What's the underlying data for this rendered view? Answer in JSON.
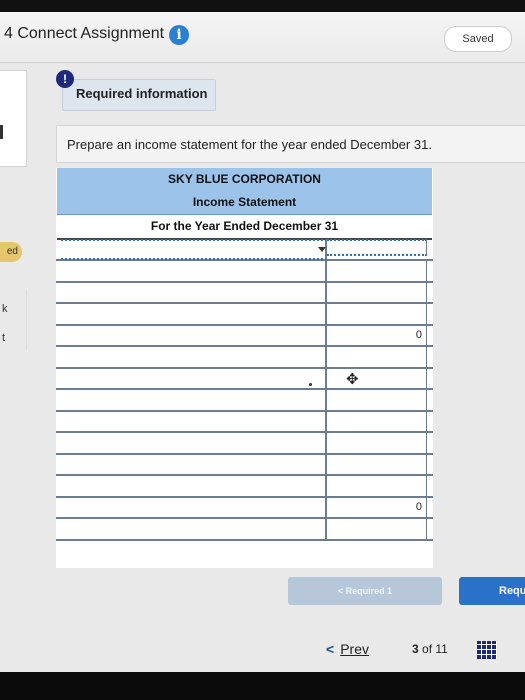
{
  "header": {
    "title": "4 Connect Assignment",
    "status": "Saved"
  },
  "left_strip": {
    "badge": "ed",
    "k": "k",
    "t": "t"
  },
  "required_tab": {
    "badge": "!",
    "label": "Required information"
  },
  "prompt": "Prepare an income statement for the year ended December 31.",
  "statement": {
    "company": "SKY BLUE CORPORATION",
    "title": "Income Statement",
    "period": "For the Year Ended December 31",
    "rows": [
      {
        "label": "",
        "amount": ""
      },
      {
        "label": "",
        "amount": ""
      },
      {
        "label": "",
        "amount": ""
      },
      {
        "label": "",
        "amount": ""
      },
      {
        "label": "",
        "amount": "0"
      },
      {
        "label": "",
        "amount": ""
      },
      {
        "label": "",
        "amount": ""
      },
      {
        "label": "",
        "amount": ""
      },
      {
        "label": "",
        "amount": ""
      },
      {
        "label": "",
        "amount": ""
      },
      {
        "label": "",
        "amount": ""
      },
      {
        "label": "",
        "amount": ""
      },
      {
        "label": "",
        "amount": "0"
      },
      {
        "label": "",
        "amount": ""
      }
    ]
  },
  "navigation": {
    "required_button": "< Required 1",
    "next_button": "Requ",
    "prev": "Prev",
    "page_current": "3",
    "page_of": "of",
    "page_total": "11"
  }
}
